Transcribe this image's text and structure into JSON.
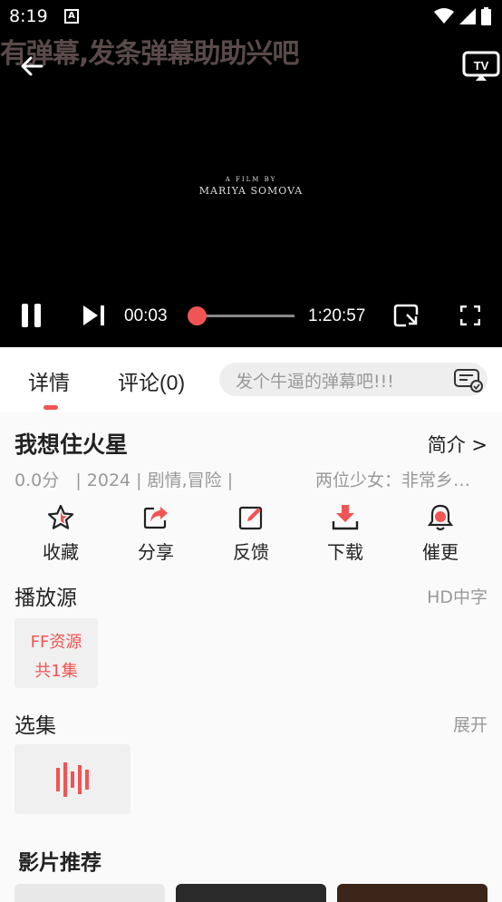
{
  "status_bar": {
    "time": "8:19",
    "notification_letter": "A"
  },
  "player": {
    "danmu_text": "有弹幕,发条弹幕助助兴吧",
    "film_credit_small": "A FILM BY",
    "film_credit_name": "MARIYA SOMOVA",
    "current_time": "00:03",
    "total_time": "1:20:57",
    "progress_fraction": 0.0006,
    "tv_label": "TV"
  },
  "tabs": {
    "details": "详情",
    "comments": "评论(0)",
    "danmu_placeholder": "发个牛逼的弹幕吧!!!"
  },
  "movie": {
    "title": "我想住火星",
    "intro_link": "简介 >",
    "score": "0.0分",
    "meta": "| 2024  |  剧情,冒险  |",
    "description": "两位少女：非常乡村的故事"
  },
  "actions": [
    {
      "label": "收藏",
      "icon": "star-icon"
    },
    {
      "label": "分享",
      "icon": "share-icon"
    },
    {
      "label": "反馈",
      "icon": "edit-icon"
    },
    {
      "label": "下载",
      "icon": "download-icon"
    },
    {
      "label": "催更",
      "icon": "bell-icon"
    }
  ],
  "source_section": {
    "title": "播放源",
    "quality": "HD中字",
    "source_name": "FF资源",
    "episode_count": "共1集"
  },
  "episode_section": {
    "title": "选集",
    "expand": "展开"
  },
  "recommend_section": {
    "title": "影片推荐"
  },
  "colors": {
    "accent": "#f05454",
    "player_bg": "#000000"
  }
}
